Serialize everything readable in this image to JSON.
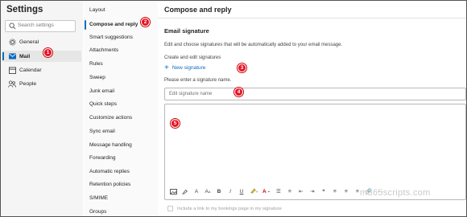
{
  "sidebar": {
    "title": "Settings",
    "search_placeholder": "Search settings",
    "items": [
      {
        "label": "General",
        "icon": "gear-icon"
      },
      {
        "label": "Mail",
        "icon": "mail-icon",
        "active": true
      },
      {
        "label": "Calendar",
        "icon": "calendar-icon"
      },
      {
        "label": "People",
        "icon": "people-icon"
      }
    ]
  },
  "submenu": {
    "items": [
      {
        "label": "Layout"
      },
      {
        "label": "Compose and reply",
        "active": true
      },
      {
        "label": "Smart suggestions"
      },
      {
        "label": "Attachments"
      },
      {
        "label": "Rules"
      },
      {
        "label": "Sweep"
      },
      {
        "label": "Junk email"
      },
      {
        "label": "Quick steps"
      },
      {
        "label": "Customize actions"
      },
      {
        "label": "Sync email"
      },
      {
        "label": "Message handling"
      },
      {
        "label": "Forwarding"
      },
      {
        "label": "Automatic replies"
      },
      {
        "label": "Retention policies"
      },
      {
        "label": "S/MIME"
      },
      {
        "label": "Groups"
      }
    ]
  },
  "main": {
    "title": "Compose and reply",
    "section_heading": "Email signature",
    "description": "Edit and choose signatures that will be automatically added to your email message.",
    "create_label": "Create and edit signatures",
    "new_signature_label": "New signature",
    "name_hint": "Please enter a signature name.",
    "name_placeholder": "Edit signature name",
    "bookings_label": "Include a link to my bookings page in my signature"
  },
  "badges": [
    "1",
    "2",
    "3",
    "4",
    "5"
  ],
  "watermark": "m365scripts.com",
  "colors": {
    "accent": "#0f6cbd",
    "badge": "#e81123"
  }
}
